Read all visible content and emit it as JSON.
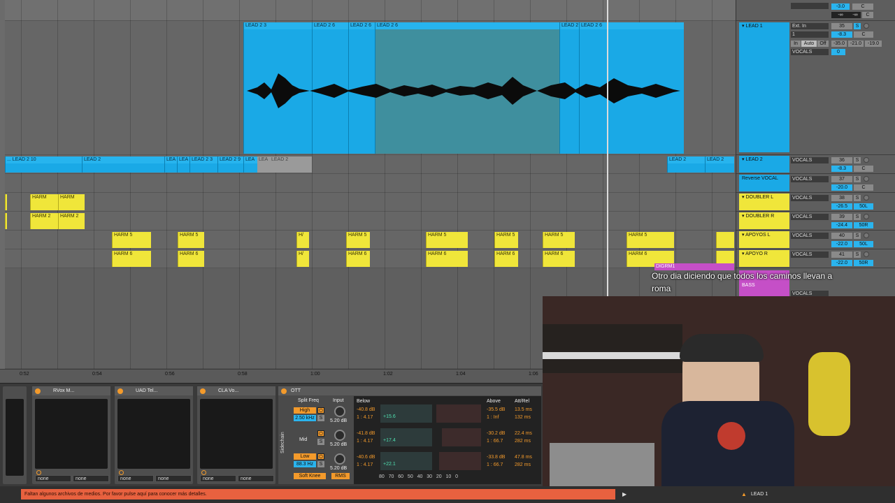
{
  "ruler": {
    "ticks": [
      "0:52",
      "0:54",
      "0:56",
      "0:58",
      "1:00",
      "1:02",
      "1:04",
      "1:06"
    ]
  },
  "lanes": {
    "lead1_clips": [
      "LEAD 2 3",
      "LEAD 2 6",
      "LEAD 2 6",
      "LEAD 2 6",
      "LEAD 2",
      "LEAD 2 6"
    ],
    "lead2_clips": [
      "... LEAD 2 10",
      "LEAD 2",
      "LEA",
      "LEA",
      "LEAD 2 3",
      "LEAD 2 9",
      "LEA",
      "LEA",
      "LEAD 2",
      "LEAD 2",
      "LEAD 2"
    ],
    "doubler_l_clips": [
      "HARM",
      "HARM"
    ],
    "doubler_r_clips": [
      "HARM 2",
      "HARM 2"
    ],
    "apoyos_l_clips": [
      "HARM 5",
      "HARM 5",
      "H/",
      "HARM 5",
      "HARM 5",
      "HARM 5",
      "HARM 5",
      "HARM 5"
    ],
    "apoyos_r_clips": [
      "HARM 6",
      "HARM 6",
      "H/",
      "HARM 6",
      "HARM 6",
      "HARM 6",
      "HARM 6",
      "HARM 6"
    ],
    "purple_clip": "DIGRM1"
  },
  "mixer": {
    "top": {
      "vol": "-3.0",
      "pan": "C",
      "inf": "-∞",
      "inf2": "-∞",
      "pan2": "C"
    },
    "lead1": {
      "name": "LEAD 1",
      "input": "Ext. In",
      "channel": "1",
      "in": "In",
      "auto": "Auto",
      "off": "Off",
      "output": "VOCALS",
      "num": "35",
      "vol": "-8.3",
      "pan": "C",
      "peak1": "-35.0",
      "peak2": "-21.0",
      "peak3": "-19.0",
      "send": "0"
    },
    "tracks": [
      {
        "name": "LEAD 2",
        "output": "VOCALS",
        "num": "36",
        "vol": "-8.3",
        "pan": "C",
        "color": "#1aa9e6"
      },
      {
        "name": "Reverse VOCAL",
        "output": "VOCALS",
        "num": "37",
        "vol": "-20.0",
        "pan": "C",
        "color": "#1aa9e6"
      },
      {
        "name": "DOUBLER L",
        "output": "VOCALS",
        "num": "38",
        "vol": "-26.5",
        "pan": "50L",
        "color": "#f0e63a"
      },
      {
        "name": "DOUBLER R",
        "output": "VOCALS",
        "num": "39",
        "vol": "-24.4",
        "pan": "50R",
        "color": "#f0e63a"
      },
      {
        "name": "APOYOS L",
        "output": "VOCALS",
        "num": "40",
        "vol": "-22.0",
        "pan": "50L",
        "color": "#f0e63a"
      },
      {
        "name": "APOYO R",
        "output": "VOCALS",
        "num": "41",
        "vol": "-22.0",
        "pan": "50R",
        "color": "#f0e63a"
      }
    ],
    "partial": {
      "bass": "BASS",
      "vocals": "VOCALS"
    }
  },
  "devices": {
    "d1": {
      "name": "RVox M...",
      "out1": "none",
      "out2": "none"
    },
    "d2": {
      "name": "UAD Tel...",
      "out1": "none",
      "out2": "none"
    },
    "d3": {
      "name": "CLA Vo...",
      "out1": "none",
      "out2": "none"
    },
    "ott": {
      "title": "OTT",
      "sidechain": "Sidechain",
      "split_freq": "Split Freq",
      "input": "Input",
      "below": "Below",
      "above": "Above",
      "att_rel": "Att/Rel",
      "high": "High",
      "high_freq": "2.50 kHz",
      "mid": "Mid",
      "low": "Low",
      "low_freq": "88.3 Hz",
      "gain_h": "5.20 dB",
      "gain_m": "5.20 dB",
      "gain_l": "5.20 dB",
      "below_h": "-40.8 dB",
      "below_h_ratio": "1 : 4.17",
      "below_h_gain": "+15.6",
      "below_m": "-41.8 dB",
      "below_m_ratio": "1 : 4.17",
      "below_m_gain": "+17.4",
      "below_l": "-40.6 dB",
      "below_l_ratio": "1 : 4.17",
      "below_l_gain": "+22.1",
      "above_h": "-35.5 dB",
      "above_h_ratio": "1 : Inf",
      "att_h": "13.5 ms",
      "rel_h": "132 ms",
      "above_m": "-30.2 dB",
      "above_m_ratio": "1 : 66.7",
      "att_m": "22.4 ms",
      "rel_m": "282 ms",
      "above_l": "-33.8 dB",
      "above_l_ratio": "1 : 66.7",
      "att_l": "47.8 ms",
      "rel_l": "282 ms",
      "scale": [
        "80",
        "70",
        "60",
        "50",
        "40",
        "30",
        "20",
        "10",
        "0"
      ],
      "soft_knee": "Soft Knee",
      "rms": "RMS"
    }
  },
  "status": {
    "warning": "Faltan algunos archivos de medios. Por favor pulse aquí para conocer más detalles.",
    "track": "LEAD 1"
  },
  "caption": {
    "line1": "Otro dia diciendo que todos los caminos llevan a",
    "line2": "roma"
  }
}
